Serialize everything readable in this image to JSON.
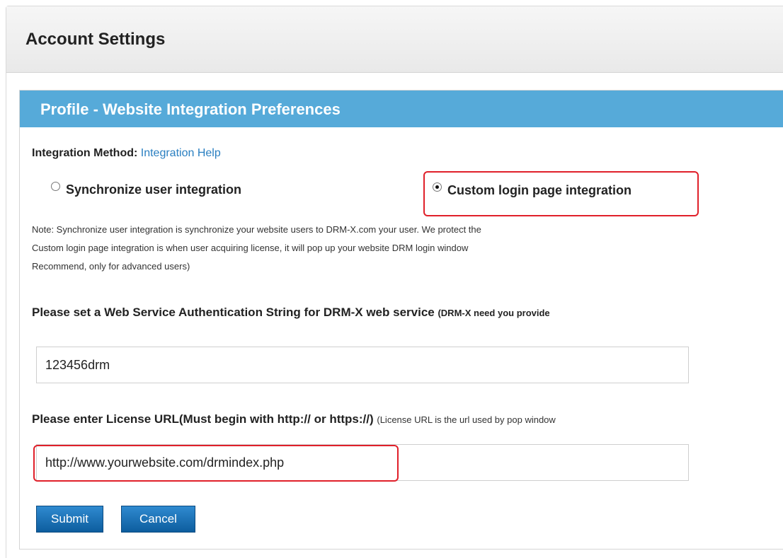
{
  "page": {
    "title": "Account Settings"
  },
  "panel": {
    "title": "Profile - Website Integration Preferences"
  },
  "integration": {
    "label": "Integration Method:",
    "help_link": "Integration Help",
    "options": [
      {
        "label": "Synchronize user integration",
        "selected": false
      },
      {
        "label": "Custom login page integration",
        "selected": true
      }
    ]
  },
  "note": {
    "lines": [
      "Note: Synchronize user integration is synchronize your website users to DRM-X.com your user. We protect the",
      "Custom login page integration is when user acquiring license, it will pop up your website DRM login window",
      "Recommend, only for advanced users)"
    ]
  },
  "auth": {
    "label": "Please set a Web Service Authentication String for DRM-X web service",
    "hint": "(DRM-X need you provide",
    "value": "123456drm"
  },
  "license": {
    "label": "Please enter License URL(Must begin with http:// or https://)",
    "hint": "(License URL is the url used by pop window",
    "value": "http://www.yourwebsite.com/drmindex.php"
  },
  "buttons": {
    "submit": "Submit",
    "cancel": "Cancel"
  },
  "colors": {
    "panel_header": "#56aad9",
    "highlight": "#e0202a",
    "button": "#1a6bb0",
    "link": "#2a7fc1"
  }
}
